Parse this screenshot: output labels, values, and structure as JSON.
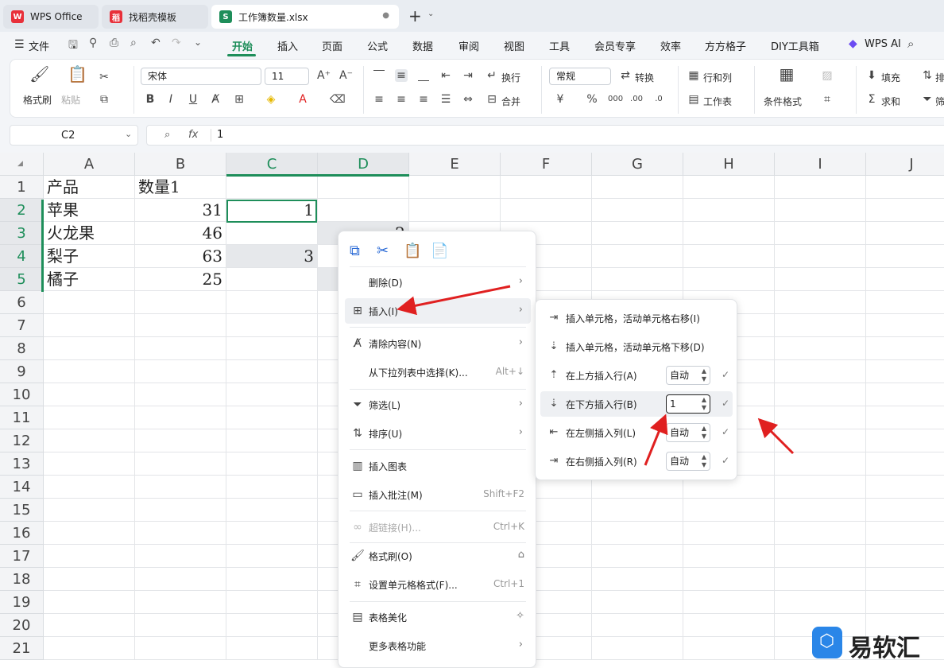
{
  "tabs": [
    {
      "label": "WPS Office",
      "logo": "W",
      "color": "#e8303a"
    },
    {
      "label": "找稻壳模板",
      "logo": "稻",
      "color": "#e8303a"
    },
    {
      "label": "工作簿数量.xlsx",
      "logo": "S",
      "color": "#1e8e5a"
    }
  ],
  "tab_add": "+",
  "menu": {
    "file": "文件",
    "items": [
      "开始",
      "插入",
      "页面",
      "公式",
      "数据",
      "审阅",
      "视图",
      "工具",
      "会员专享",
      "效率",
      "方方格子",
      "DIY工具箱"
    ],
    "active": "开始",
    "wps_ai": "WPS AI"
  },
  "ribbon": {
    "format_painter": "格式刷",
    "paste": "粘贴",
    "font_name": "宋体",
    "font_size": "11",
    "wrap": "换行",
    "merge": "合并",
    "number_format": "常规",
    "convert": "转换",
    "row_col": "行和列",
    "worksheet": "工作表",
    "cond_format": "条件格式",
    "fill": "填充",
    "sum": "求和",
    "sort": "排",
    "filter": "筛"
  },
  "formula_bar": {
    "cell_ref": "C2",
    "fx": "fx",
    "value": "1"
  },
  "columns": [
    "A",
    "B",
    "C",
    "D",
    "E",
    "F",
    "G",
    "H",
    "I",
    "J"
  ],
  "rows": [
    "1",
    "2",
    "3",
    "4",
    "5",
    "6",
    "7",
    "8",
    "9",
    "10",
    "11",
    "12",
    "13",
    "14",
    "15",
    "16",
    "17",
    "18",
    "19",
    "20",
    "21"
  ],
  "cells": {
    "A1": "产品",
    "B1": "数量1",
    "A2": "苹果",
    "B2": "31",
    "C2": "1",
    "A3": "火龙果",
    "B3": "46",
    "D3": "2",
    "A4": "梨子",
    "B4": "63",
    "C4": "3",
    "A5": "橘子",
    "B5": "25"
  },
  "context_menu": {
    "delete": "删除(D)",
    "insert": "插入(I)",
    "clear": "清除内容(N)",
    "pick_list": "从下拉列表中选择(K)...",
    "pick_list_sc": "Alt+↓",
    "filter": "筛选(L)",
    "sort": "排序(U)",
    "insert_chart": "插入图表",
    "insert_comment": "插入批注(M)",
    "insert_comment_sc": "Shift+F2",
    "hyperlink": "超链接(H)...",
    "hyperlink_sc": "Ctrl+K",
    "format_painter": "格式刷(O)",
    "format_cells": "设置单元格格式(F)...",
    "format_cells_sc": "Ctrl+1",
    "beautify": "表格美化",
    "more": "更多表格功能"
  },
  "submenu": {
    "shift_right": "插入单元格，活动单元格右移(I)",
    "shift_down": "插入单元格，活动单元格下移(D)",
    "row_above": "在上方插入行(A)",
    "row_above_val": "自动",
    "row_below": "在下方插入行(B)",
    "row_below_val": "1",
    "col_left": "在左侧插入列(L)",
    "col_left_val": "自动",
    "col_right": "在右侧插入列(R)",
    "col_right_val": "自动"
  },
  "watermark": "易软汇"
}
